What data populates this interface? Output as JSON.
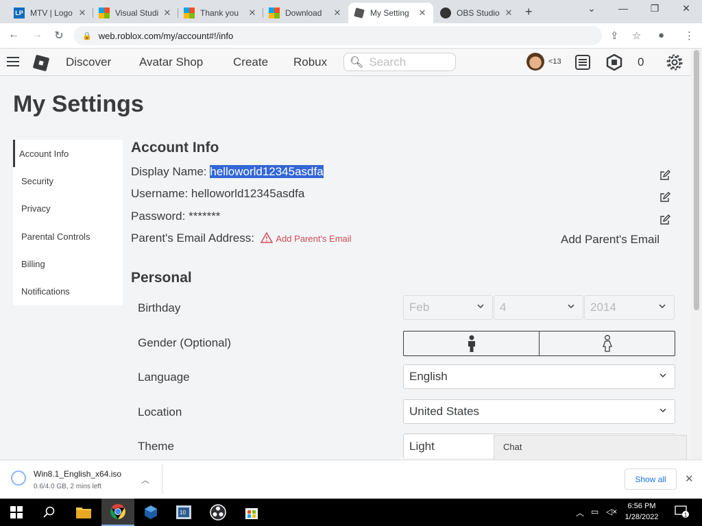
{
  "browser": {
    "tabs": [
      {
        "title": "MTV | Logo",
        "icon": "lp-icon"
      },
      {
        "title": "Visual Studi",
        "icon": "microsoft-icon"
      },
      {
        "title": "Thank you",
        "icon": "microsoft-icon"
      },
      {
        "title": "Download",
        "icon": "microsoft-icon"
      },
      {
        "title": "My Setting",
        "icon": "roblox-icon",
        "active": true
      },
      {
        "title": "OBS Studio",
        "icon": "obs-icon"
      }
    ],
    "url": "web.roblox.com/my/account#!/info"
  },
  "header": {
    "nav": [
      "Discover",
      "Avatar Shop",
      "Create",
      "Robux"
    ],
    "search_placeholder": "Search",
    "age_label": "<13",
    "robux_balance": "0"
  },
  "page": {
    "title": "My Settings",
    "side_menu": [
      "Account Info",
      "Security",
      "Privacy",
      "Parental Controls",
      "Billing",
      "Notifications"
    ],
    "account_info": {
      "section_title": "Account Info",
      "display_name_label": "Display Name:",
      "display_name_value": "helloworld12345asdfa",
      "username_label": "Username:",
      "username_value": "helloworld12345asdfa",
      "password_label": "Password:",
      "password_value": "*******",
      "parent_email_label": "Parent's Email Address:",
      "parent_email_warning": "Add Parent's Email",
      "add_parent_email_button": "Add Parent's Email"
    },
    "personal": {
      "section_title": "Personal",
      "birthday_label": "Birthday",
      "birthday_month": "Feb",
      "birthday_day": "4",
      "birthday_year": "2014",
      "gender_label": "Gender (Optional)",
      "language_label": "Language",
      "language_value": "English",
      "location_label": "Location",
      "location_value": "United States",
      "theme_label": "Theme",
      "theme_value": "Light"
    },
    "chat_label": "Chat"
  },
  "downloads": {
    "file_name": "Win8.1_English_x64.iso",
    "status": "0.6/4.0 GB, 2 mins left",
    "show_all": "Show all"
  },
  "taskbar": {
    "time": "6:56 PM",
    "date": "1/28/2022",
    "notification_count": "1"
  }
}
